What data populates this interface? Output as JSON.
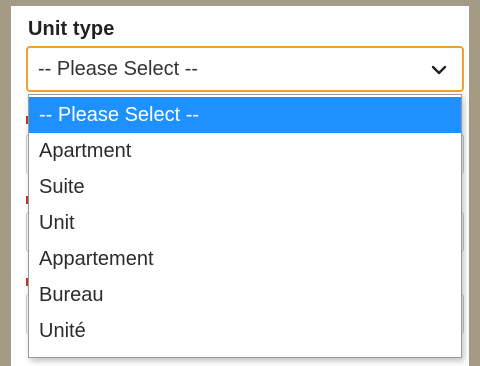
{
  "field": {
    "label": "Unit type",
    "selected_value": "-- Please Select --"
  },
  "dropdown": {
    "options": [
      {
        "label": "-- Please Select --",
        "selected": true
      },
      {
        "label": "Apartment",
        "selected": false
      },
      {
        "label": "Suite",
        "selected": false
      },
      {
        "label": "Unit",
        "selected": false
      },
      {
        "label": "Appartement",
        "selected": false
      },
      {
        "label": "Bureau",
        "selected": false
      },
      {
        "label": "Unité",
        "selected": false
      }
    ]
  },
  "colors": {
    "focus_border": "#f0a030",
    "selected_option_bg": "#1e90ff",
    "frame": "#a59a86"
  },
  "icons": {
    "select_arrow": "chevron-down-icon"
  }
}
